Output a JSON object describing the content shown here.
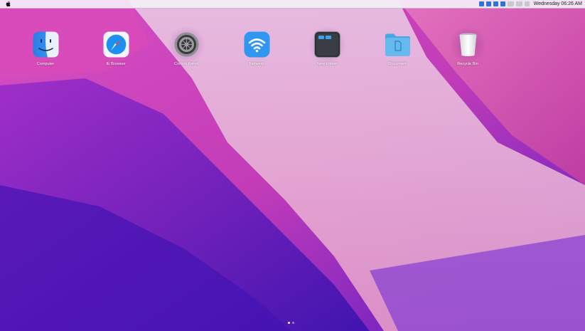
{
  "menubar": {
    "clock": "Wednesday 06:26 AM",
    "tray_icons": [
      "blue-app-icon",
      "blue-app-icon",
      "blue-app-icon",
      "blue-app-icon",
      "wifi-icon",
      "battery-icon",
      "volume-icon"
    ]
  },
  "desktop": {
    "icons": [
      {
        "label": "Computer",
        "icon": "finder-icon"
      },
      {
        "label": "IE Browser",
        "icon": "safari-compass-icon"
      },
      {
        "label": "Control Panel",
        "icon": "settings-gear-icon"
      },
      {
        "label": "Network",
        "icon": "wifi-icon"
      },
      {
        "label": "New Folder",
        "icon": "window-manager-icon"
      },
      {
        "label": "Document",
        "icon": "folder-icon"
      },
      {
        "label": "Recycle Bin",
        "icon": "trash-can-icon"
      }
    ]
  },
  "pager": {
    "pages": 2,
    "active": 1
  },
  "colors": {
    "accent": "#2f73d6",
    "wallpaper_top": "#e3a1d6",
    "wallpaper_bottom": "#3a0fb0"
  }
}
